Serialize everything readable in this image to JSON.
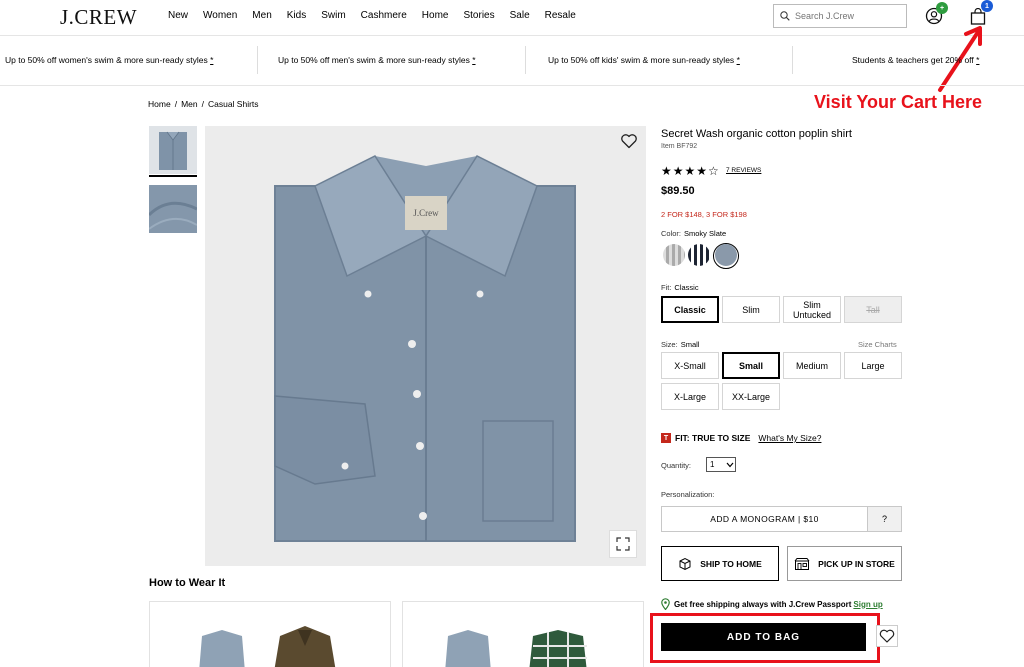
{
  "header": {
    "logo": "J.CREW",
    "nav": [
      "New",
      "Women",
      "Men",
      "Kids",
      "Swim",
      "Cashmere",
      "Home",
      "Stories",
      "Sale",
      "Resale"
    ],
    "search_placeholder": "Search J.Crew",
    "cart_count": "1"
  },
  "promos": [
    {
      "text": "Up to 50% off women's swim & more sun-ready styles",
      "mark": "*"
    },
    {
      "text": "Up to 50% off men's swim & more sun-ready styles",
      "mark": "*"
    },
    {
      "text": "Up to 50% off kids' swim & more sun-ready styles",
      "mark": "*"
    },
    {
      "text": "Students & teachers get 20% off",
      "mark": "*"
    }
  ],
  "annotation": {
    "text": "Visit Your Cart Here"
  },
  "breadcrumb": [
    "Home",
    "/",
    "Men",
    "/",
    "Casual Shirts"
  ],
  "product": {
    "title": "Secret Wash organic cotton poplin shirt",
    "item_no": "Item BF792",
    "stars": "★★★★☆",
    "rating": 4,
    "reviews": "7 REVIEWS",
    "price": "$89.50",
    "deal": "2 FOR $148, 3 FOR $198",
    "color_label": "Color:",
    "color_value": "Smoky Slate",
    "fit_label": "Fit:",
    "fit_value": "Classic",
    "fits": [
      "Classic",
      "Slim",
      "Slim Untucked",
      "Tall"
    ],
    "size_label": "Size:",
    "size_value": "Small",
    "size_charts": "Size Charts",
    "sizes": [
      "X-Small",
      "Small",
      "Medium",
      "Large",
      "X-Large",
      "XX-Large"
    ],
    "fit_true": "FIT: TRUE TO SIZE",
    "whats_my_size": "What's My Size?",
    "fit_badge": "T",
    "quantity_label": "Quantity:",
    "quantity_value": "1",
    "personalization_label": "Personalization:",
    "monogram": "ADD A MONOGRAM | $10",
    "monogram_help": "?",
    "ship_home": "SHIP TO HOME",
    "pick_up": "PICK UP IN STORE",
    "passport_text": "Get free shipping always with J.Crew Passport",
    "passport_link": "Sign up",
    "add_to_bag": "ADD TO BAG"
  },
  "how_to_wear": "How to Wear It",
  "colors": {
    "accent_red": "#e8121b",
    "deal_red": "#c4281c",
    "passport_green": "#2e7d32"
  }
}
